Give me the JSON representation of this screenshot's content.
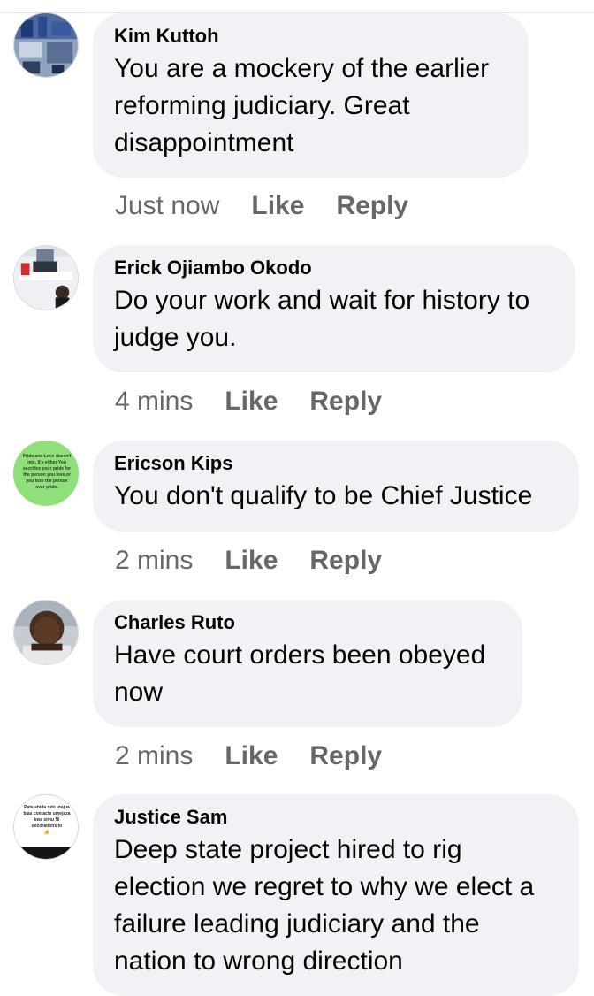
{
  "comments": [
    {
      "author": "Kim Kuttoh",
      "text_lines": [
        "You are a mockery of the earlier",
        "reforming judiciary.  Great",
        "disappointment"
      ],
      "time": "Just now",
      "like": "Like",
      "reply": "Reply"
    },
    {
      "author": "Erick Ojiambo Okodo",
      "text_lines": [
        "Do your work and wait for history to",
        "judge you."
      ],
      "time": "4 mins",
      "like": "Like",
      "reply": "Reply"
    },
    {
      "author": "Ericson Kips",
      "text_lines": [
        "You don't qualify to be Chief Justice"
      ],
      "time": "2 mins",
      "like": "Like",
      "reply": "Reply"
    },
    {
      "author": "Charles Ruto",
      "text_lines": [
        "Have court orders been obeyed",
        "now"
      ],
      "time": "2 mins",
      "like": "Like",
      "reply": "Reply"
    },
    {
      "author": "Justice Sam",
      "text_lines": [
        "Deep state project hired to rig",
        "election we regret to why we elect a",
        "failure leading judiciary and the",
        "nation to wrong direction"
      ],
      "time": "",
      "like": "",
      "reply": ""
    }
  ],
  "avatars": {
    "ericson": [
      "Pride and Love doesn't",
      "mix. It's either You",
      "sacrifice your pride for",
      "the person you love,or",
      "you lose the person",
      "over pride."
    ],
    "justice": [
      "Pata shida ndo utajua",
      "bias contacts umejaza",
      "kwa simu Ni",
      "decorations to",
      "👍"
    ]
  },
  "colors": {
    "bubble": "#f0f2f5",
    "meta_text": "#65676b",
    "name_text": "#050505",
    "ericson_avatar_bg": "#8fe07a"
  }
}
